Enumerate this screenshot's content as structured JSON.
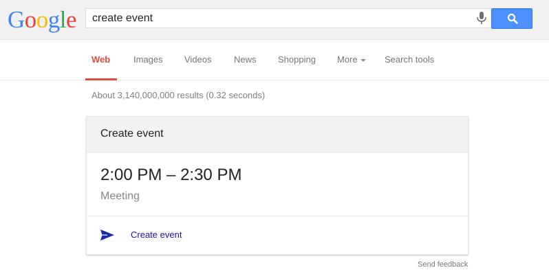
{
  "header": {
    "logo_text": "Google",
    "search_value": "create event"
  },
  "nav": {
    "tabs": [
      {
        "label": "Web",
        "active": true
      },
      {
        "label": "Images"
      },
      {
        "label": "Videos"
      },
      {
        "label": "News"
      },
      {
        "label": "Shopping"
      },
      {
        "label": "More"
      },
      {
        "label": "Search tools"
      }
    ],
    "accent_color": "#dd4b39"
  },
  "results": {
    "stats": "About 3,140,000,000 results (0.32 seconds)"
  },
  "card": {
    "title": "Create event",
    "time_range": "2:00 PM – 2:30 PM",
    "subject": "Meeting",
    "action_label": "Create event",
    "action_icon": "send-icon"
  },
  "footer": {
    "feedback": "Send feedback"
  },
  "colors": {
    "search_button": "#4d90fe",
    "link": "#1a0dab"
  }
}
